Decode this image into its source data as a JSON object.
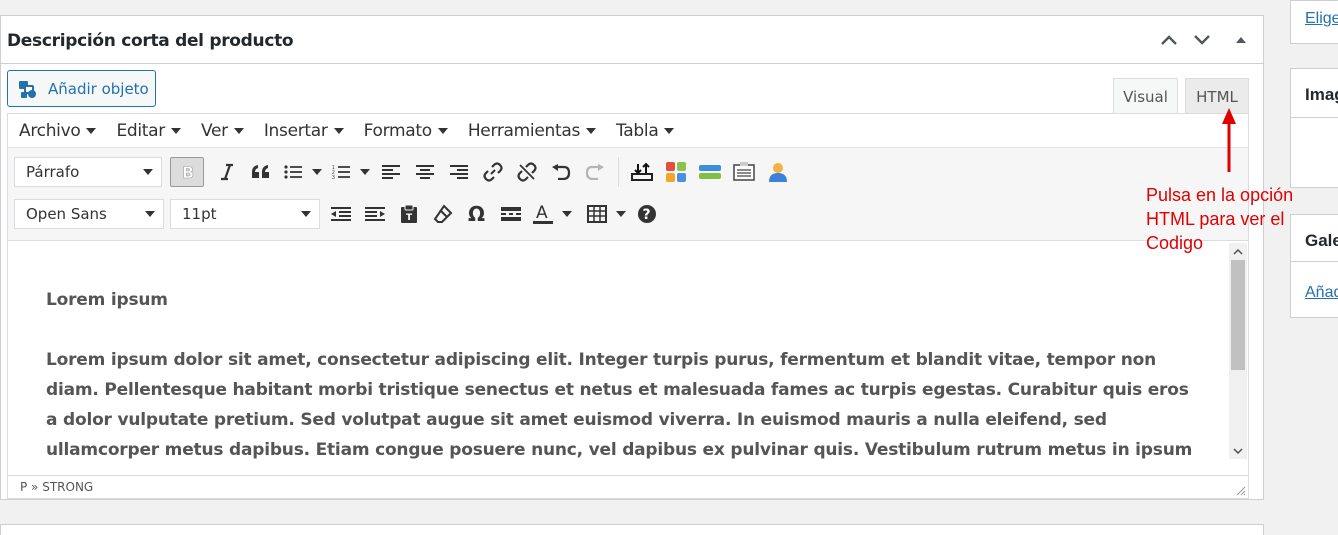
{
  "panel": {
    "title": "Descripción corta del producto",
    "add_object_label": "Añadir objeto"
  },
  "tabs": {
    "visual": "Visual",
    "html": "HTML"
  },
  "menubar": [
    {
      "label": "Archivo"
    },
    {
      "label": "Editar"
    },
    {
      "label": "Ver"
    },
    {
      "label": "Insertar"
    },
    {
      "label": "Formato"
    },
    {
      "label": "Herramientas"
    },
    {
      "label": "Tabla"
    }
  ],
  "toolbar": {
    "block_format": "Párrafo",
    "font_family": "Open Sans",
    "font_size": "11pt"
  },
  "content": {
    "heading": "Lorem ipsum",
    "body": "Lorem ipsum dolor sit amet, consectetur adipiscing elit. Integer turpis purus, fermentum et blandit vitae, tempor non diam. Pellentesque habitant morbi tristique senectus et netus et malesuada fames ac turpis egestas. Curabitur quis eros a dolor vulputate pretium. Sed volutpat augue sit amet euismod viverra. In euismod mauris a nulla eleifend, sed ullamcorper metus dapibus. Etiam congue posuere nunc, vel dapibus ex pulvinar quis. Vestibulum rutrum metus in ipsum efficitur tincidunt. Nullam"
  },
  "statusbar": {
    "path": "P » STRONG"
  },
  "annotation": {
    "text": "Pulsa en la opción HTML para ver el Codigo",
    "color": "#e00000"
  },
  "sidebar": {
    "link_top": "Elige",
    "image_title": "Imag",
    "gallery_title": "Gale",
    "gallery_link": "Añad"
  },
  "colors": {
    "accent": "#2271b1",
    "annotation": "#e00000"
  }
}
